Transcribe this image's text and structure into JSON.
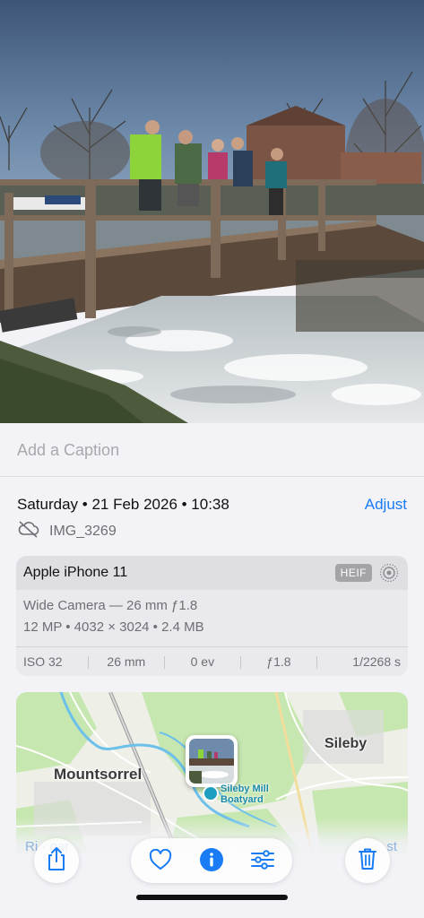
{
  "caption": {
    "placeholder": "Add a Caption"
  },
  "metadata": {
    "date": "Saturday • 21 Feb 2026 • 10:38",
    "adjust_label": "Adjust",
    "filename": "IMG_3269",
    "icons": {
      "cloud": "cloud-slash-icon"
    }
  },
  "camera": {
    "device": "Apple iPhone 11",
    "format_badge": "HEIF",
    "lens": "Wide Camera — 26 mm ƒ1.8",
    "specs": "12 MP • 4032 × 3024 • 2.4 MB",
    "exif": [
      "ISO 32",
      "26 mm",
      "0 ev",
      "ƒ1.8",
      "1/2268 s"
    ]
  },
  "map": {
    "labels": {
      "town_left": "Mountsorrel",
      "town_right": "Sileby",
      "poi": "Sileby Mill Boatyard"
    }
  },
  "toolbar": {
    "ghost_left": "Ri  ·  oar",
    "ghost_right": "st",
    "buttons": [
      "share-icon",
      "heart-icon",
      "info-icon",
      "adjust-sliders-icon",
      "trash-icon"
    ]
  },
  "colors": {
    "accent": "#1a7cf5",
    "background": "#f2f2f7",
    "map_green": "#c7e7b0",
    "map_water": "#9fd7f5"
  }
}
